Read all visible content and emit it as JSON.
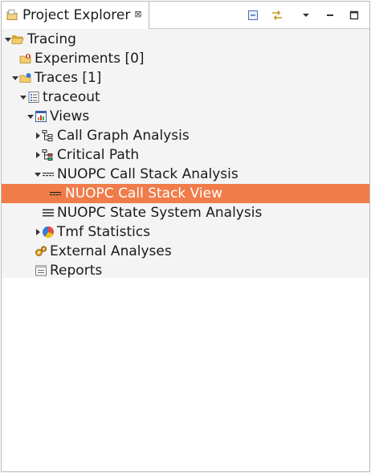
{
  "view": {
    "tab_title": "Project Explorer",
    "tab_close_glyph": "⊠"
  },
  "toolbar": {
    "icons": [
      "collapse-all-icon",
      "link-with-editor-icon",
      "view-menu-icon",
      "minimize-icon",
      "maximize-icon"
    ]
  },
  "tree": {
    "tracing": "Tracing",
    "experiments": "Experiments [0]",
    "traces": "Traces [1]",
    "traceout": "traceout",
    "views": "Views",
    "call_graph": "Call Graph Analysis",
    "critical_path": "Critical Path",
    "nuopc_call_stack_analysis": "NUOPC Call Stack Analysis",
    "nuopc_call_stack_view": "NUOPC Call Stack View",
    "nuopc_state_system": "NUOPC State System Analysis",
    "tmf_statistics": "Tmf Statistics",
    "external_analyses": "External Analyses",
    "reports": "Reports"
  },
  "colors": {
    "selection": "#f07c4a",
    "tree_background": "#f4f4f4",
    "folder_yellow": "#e8b64a"
  }
}
